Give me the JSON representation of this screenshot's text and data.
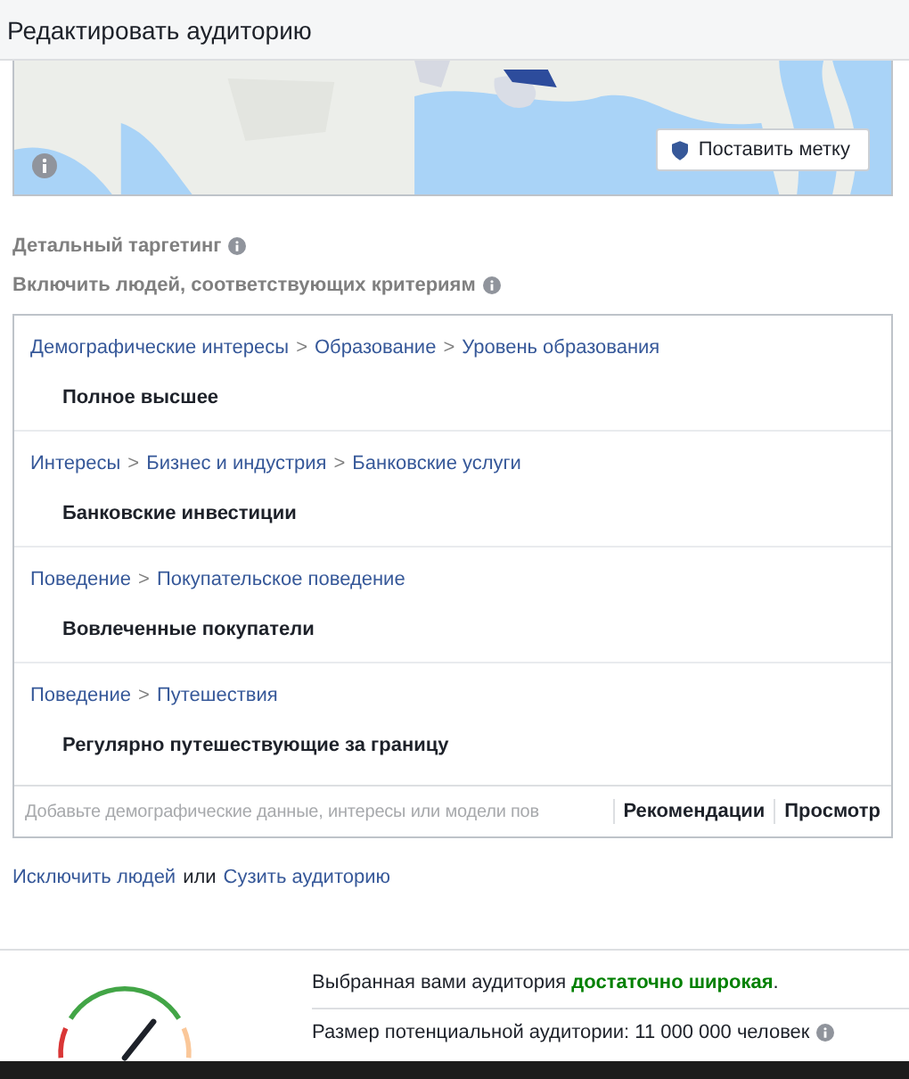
{
  "window": {
    "title": "Редактировать аудиторию"
  },
  "map": {
    "pin_button": "Поставить метку"
  },
  "detailed_targeting": {
    "label": "Детальный таргетинг"
  },
  "include": {
    "label": "Включить людей, соответствующих критериям"
  },
  "criteria": [
    {
      "path": [
        "Демографические интересы",
        "Образование",
        "Уровень образования"
      ],
      "separator": ">",
      "item": "Полное высшее"
    },
    {
      "path": [
        "Интересы",
        "Бизнес и индустрия",
        "Банковские услуги"
      ],
      "separator": ">",
      "item": "Банковские инвестиции"
    },
    {
      "path": [
        "Поведение",
        "Покупательское поведение"
      ],
      "separator": ">",
      "item": "Вовлеченные покупатели"
    },
    {
      "path": [
        "Поведение",
        "Путешествия"
      ],
      "separator": ">",
      "item": "Регулярно путешествующие за границу"
    }
  ],
  "search": {
    "placeholder": "Добавьте демографические данные, интересы или модели пов",
    "actions": [
      "Рекомендации",
      "Просмотр"
    ]
  },
  "links": {
    "exclude": "Исключить людей",
    "joiner": "или",
    "narrow": "Сузить аудиторию"
  },
  "audience": {
    "summary_prefix": "Выбранная вами аудитория",
    "summary_highlight": "достаточно широкая",
    "summary_suffix": ".",
    "size": "Размер потенциальной аудитории: 11 000 000 человек"
  }
}
